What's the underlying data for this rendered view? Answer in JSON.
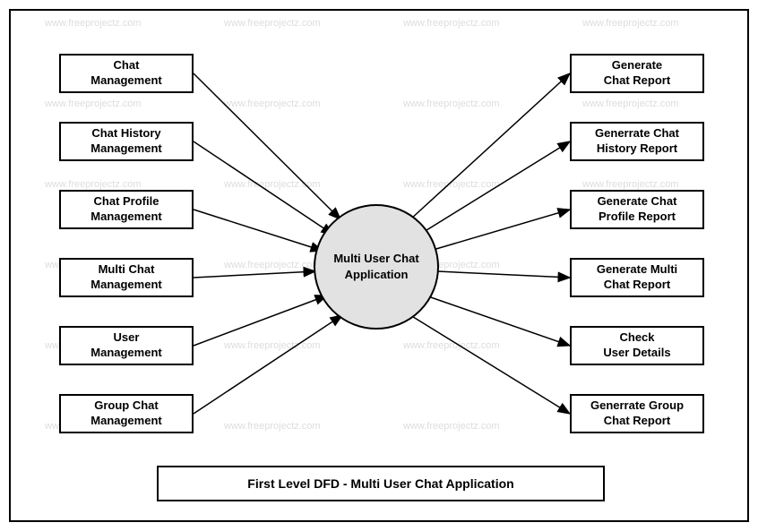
{
  "diagram": {
    "title": "First Level DFD - Multi User Chat Application",
    "center": "Multi User Chat\nApplication",
    "left_boxes": [
      "Chat\nManagement",
      "Chat History\nManagement",
      "Chat Profile\nManagement",
      "Multi Chat\nManagement",
      "User\nManagement",
      "Group Chat\nManagement"
    ],
    "right_boxes": [
      "Generate\nChat Report",
      "Generrate Chat\nHistory Report",
      "Generate Chat\nProfile Report",
      "Generate Multi\nChat Report",
      "Check\nUser Details",
      "Generrate Group\nChat Report"
    ],
    "watermark": "www.freeprojectz.com"
  }
}
